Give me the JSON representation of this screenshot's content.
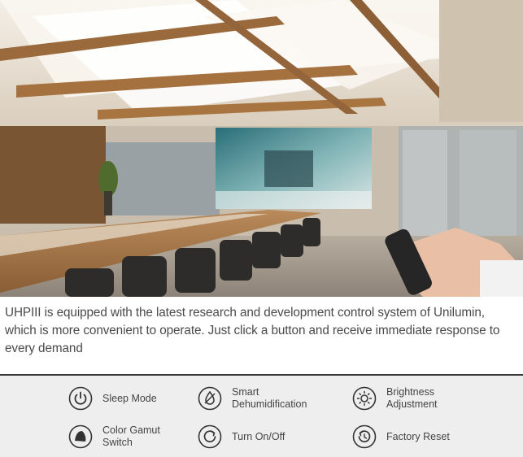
{
  "hero": {
    "alt": "Conference room with LED display and remote control"
  },
  "description": "UHPIII is equipped with the latest research and development control system of Unilumin, which is more convenient to operate. Just click a button and receive immediate response to every demand",
  "features": [
    {
      "label": "Sleep Mode",
      "icon": "power-icon"
    },
    {
      "label": "Smart\nDehumidification",
      "icon": "droplet-icon"
    },
    {
      "label": "Brightness\nAdjustment",
      "icon": "sun-icon"
    },
    {
      "label": "Color Gamut\nSwitch",
      "icon": "color-gamut-icon"
    },
    {
      "label": "Turn On/Off",
      "icon": "turn-on-off-icon"
    },
    {
      "label": "Factory Reset",
      "icon": "reset-icon"
    }
  ]
}
